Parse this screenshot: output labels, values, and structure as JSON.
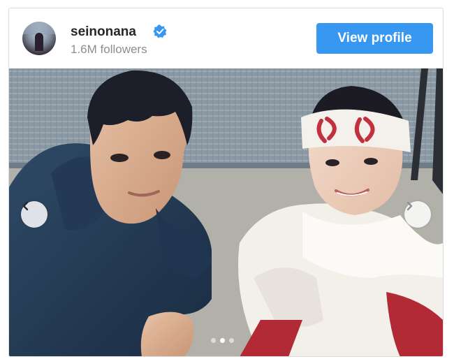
{
  "header": {
    "username": "seinonana",
    "followers": "1.6M followers",
    "verified_icon": "verified-badge-icon",
    "view_profile_label": "View profile"
  },
  "carousel": {
    "total_slides": 3,
    "active_slide": 2,
    "prev_icon": "chevron-left-icon",
    "next_icon": "chevron-right-icon"
  },
  "colors": {
    "accent": "#3897f0",
    "username": "#262626",
    "muted": "#8e8e8e"
  }
}
